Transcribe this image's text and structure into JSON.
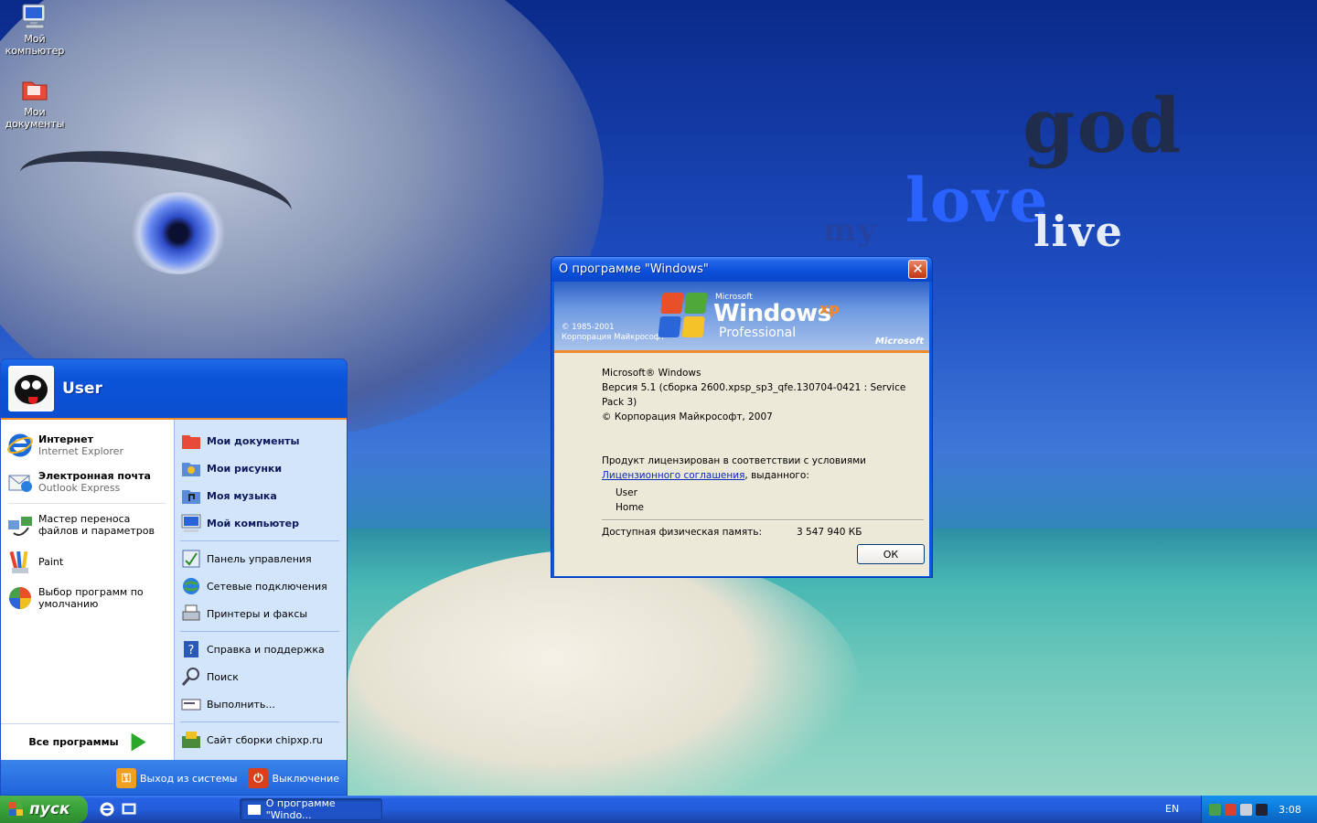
{
  "desktop": {
    "wallpaper_words": [
      "god",
      "love",
      "live",
      "my"
    ],
    "icons": [
      {
        "label": "Мой компьютер",
        "icon": "computer-icon"
      },
      {
        "label": "Мои документы",
        "icon": "folder-icon"
      }
    ]
  },
  "about_window": {
    "title": "О программе \"Windows\"",
    "close_label": "✕",
    "banner": {
      "copyright_years": "© 1985-2001",
      "copyright_company": "Корпорация Майкрософт",
      "microsoft_small": "Microsoft",
      "windows": "Windows",
      "xp": "xp",
      "edition": "Professional",
      "microsoft_logo": "Microsoft"
    },
    "product_name": "Microsoft® Windows",
    "version": "Версия 5.1 (сборка 2600.xpsp_sp3_qfe.130704-0421 : Service Pack 3)",
    "copyright": "© Корпорация Майкрософт, 2007",
    "license_text": "Продукт лицензирован в соответствии с условиями",
    "license_link": "Лицензионного соглашения",
    "license_suffix": ", выданного:",
    "licensed_user": "User",
    "licensed_org": "Home",
    "memory_label": "Доступная физическая память:",
    "memory_value": "3 547 940 КБ",
    "ok_label": "ОК"
  },
  "start_menu": {
    "user_name": "User",
    "pinned": [
      {
        "title": "Интернет",
        "subtitle": "Internet Explorer",
        "icon": "internet-explorer-icon"
      },
      {
        "title": "Электронная почта",
        "subtitle": "Outlook Express",
        "icon": "email-icon"
      }
    ],
    "recent": [
      {
        "label": "Мастер переноса файлов и параметров",
        "icon": "transfer-wizard-icon"
      },
      {
        "label": "Paint",
        "icon": "paint-icon"
      },
      {
        "label": "Выбор программ по умолчанию",
        "icon": "default-programs-icon"
      }
    ],
    "all_programs": "Все программы",
    "places": [
      {
        "label": "Мои документы",
        "icon": "folder-icon"
      },
      {
        "label": "Мои рисунки",
        "icon": "pictures-icon"
      },
      {
        "label": "Моя музыка",
        "icon": "music-icon"
      },
      {
        "label": "Мой компьютер",
        "icon": "computer-icon"
      }
    ],
    "system": [
      {
        "label": "Панель управления",
        "icon": "control-panel-icon"
      },
      {
        "label": "Сетевые подключения",
        "icon": "network-icon"
      },
      {
        "label": "Принтеры и факсы",
        "icon": "printer-icon"
      }
    ],
    "tools": [
      {
        "label": "Справка и поддержка",
        "icon": "help-icon"
      },
      {
        "label": "Поиск",
        "icon": "search-icon"
      },
      {
        "label": "Выполнить...",
        "icon": "run-icon"
      }
    ],
    "extra": [
      {
        "label": "Сайт сборки chipxp.ru",
        "icon": "website-icon"
      }
    ],
    "logoff_label": "Выход из системы",
    "shutdown_label": "Выключение"
  },
  "taskbar": {
    "start_label": "пуск",
    "task_label": "О программе \"Windo...",
    "language": "EN",
    "clock": "3:08"
  },
  "colors": {
    "xp_blue": "#0a58e0",
    "start_green": "#39a33a",
    "accent_orange": "#f08a2a"
  }
}
